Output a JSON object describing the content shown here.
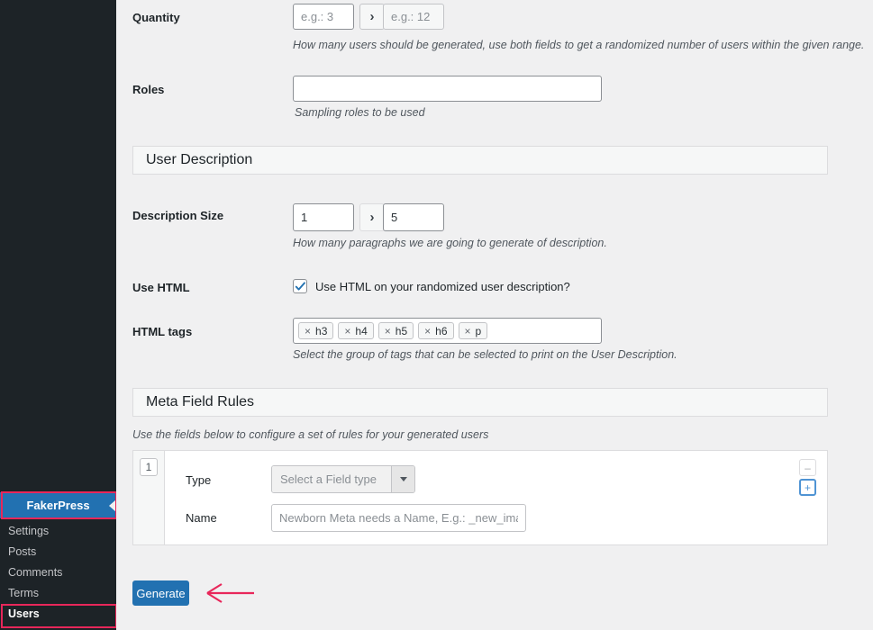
{
  "theme": {
    "sidebar_bg": "#1d2327",
    "content_bg": "#f0f0f1",
    "accent_blue": "#2271b1",
    "annotation_pink": "#e8275a"
  },
  "sidebar": {
    "menu_item": {
      "label": "FakerPress",
      "active": true
    },
    "submenu": [
      {
        "label": "Settings",
        "current": false
      },
      {
        "label": "Posts",
        "current": false
      },
      {
        "label": "Comments",
        "current": false
      },
      {
        "label": "Terms",
        "current": false
      },
      {
        "label": "Users",
        "current": true
      }
    ]
  },
  "form": {
    "quantity": {
      "label": "Quantity",
      "min_placeholder": "e.g.: 3",
      "min_value": "",
      "separator": "›",
      "max_placeholder": "e.g.: 12",
      "max_value": "",
      "description": "How many users should be generated, use both fields to get a randomized number of users within the given range."
    },
    "roles": {
      "label": "Roles",
      "value": "",
      "placeholder": "",
      "description": "Sampling roles to be used"
    },
    "user_description_section": {
      "title": "User Description",
      "description_size": {
        "label": "Description Size",
        "min_value": "1",
        "max_value": "5",
        "separator": "›",
        "description": "How many paragraphs we are going to generate of description."
      },
      "use_html": {
        "label": "Use HTML",
        "checked": true,
        "checkbox_text": "Use HTML on your randomized user description?"
      },
      "html_tags": {
        "label": "HTML tags",
        "tags": [
          "h3",
          "h4",
          "h5",
          "h6",
          "p"
        ],
        "remove_glyph": "×",
        "description": "Select the group of tags that can be selected to print on the User Description."
      }
    },
    "meta_field_rules": {
      "title": "Meta Field Rules",
      "intro": "Use the fields below to configure a set of rules for your generated users",
      "rows": [
        {
          "index": "1",
          "type_label": "Type",
          "type_value": "Select a Field type",
          "name_label": "Name",
          "name_value": "",
          "name_placeholder": "Newborn Meta needs a Name, E.g.: _new_image"
        }
      ],
      "remove_row_label": "–",
      "add_row_label": "+"
    },
    "submit": {
      "label": "Generate"
    }
  }
}
